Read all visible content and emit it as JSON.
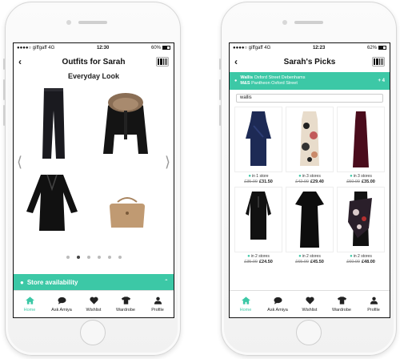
{
  "colors": {
    "accent": "#3cc8a6",
    "text": "#222222"
  },
  "left_screen": {
    "status": {
      "carrier": "giffgaff",
      "network": "4G",
      "time": "12:30",
      "battery": "60%"
    },
    "nav": {
      "back_icon": "chevron-left-icon",
      "title": "Outfits for Sarah",
      "barcode_icon": "barcode-icon"
    },
    "look_title": "Everyday Look",
    "outfit_items": [
      {
        "name": "black jeans"
      },
      {
        "name": "fur collar jacket"
      },
      {
        "name": "black blouse"
      },
      {
        "name": "tan bag"
      }
    ],
    "carousel": {
      "page_count": 6,
      "active_index": 1
    },
    "store_bar": {
      "label": "Store availability",
      "icon": "location-pin-icon",
      "toggle_icon": "chevron-up-icon"
    }
  },
  "right_screen": {
    "status": {
      "carrier": "giffgaff",
      "network": "4G",
      "time": "12:23",
      "battery": "62%"
    },
    "nav": {
      "back_icon": "chevron-left-icon",
      "title": "Sarah's Picks",
      "barcode_icon": "barcode-icon"
    },
    "stores_banner": {
      "line1_brand": "Wallis",
      "line1_stores": "Oxford Street Debenhams",
      "line2_brand": "M&S",
      "line2_stores": "Pantheon Oxford Street",
      "more": "+ 4"
    },
    "search": {
      "value": "wallis"
    },
    "products": [
      {
        "availability": "in 1 store",
        "old_price": "£35.00",
        "price": "£31.50",
        "icon": "navy-wrap-dress"
      },
      {
        "availability": "in 3 stores",
        "old_price": "£42.00",
        "price": "£29.40",
        "icon": "floral-dress"
      },
      {
        "availability": "in 3 stores",
        "old_price": "£50.00",
        "price": "£35.00",
        "icon": "maroon-maxi-dress"
      },
      {
        "availability": "in 2 stores",
        "old_price": "£35.00",
        "price": "£24.50",
        "icon": "black-shift-dress"
      },
      {
        "availability": "in 2 stores",
        "old_price": "£65.00",
        "price": "£45.50",
        "icon": "black-maxi-dress"
      },
      {
        "availability": "in 2 stores",
        "old_price": "£60.00",
        "price": "£48.00",
        "icon": "printed-scarf-dress"
      }
    ]
  },
  "tabs": [
    {
      "label": "Home",
      "icon": "home-icon"
    },
    {
      "label": "Ask Amiya",
      "icon": "chat-icon"
    },
    {
      "label": "Wishlist",
      "icon": "heart-icon"
    },
    {
      "label": "Wardrobe",
      "icon": "tshirt-icon"
    },
    {
      "label": "Profile",
      "icon": "person-icon"
    }
  ]
}
